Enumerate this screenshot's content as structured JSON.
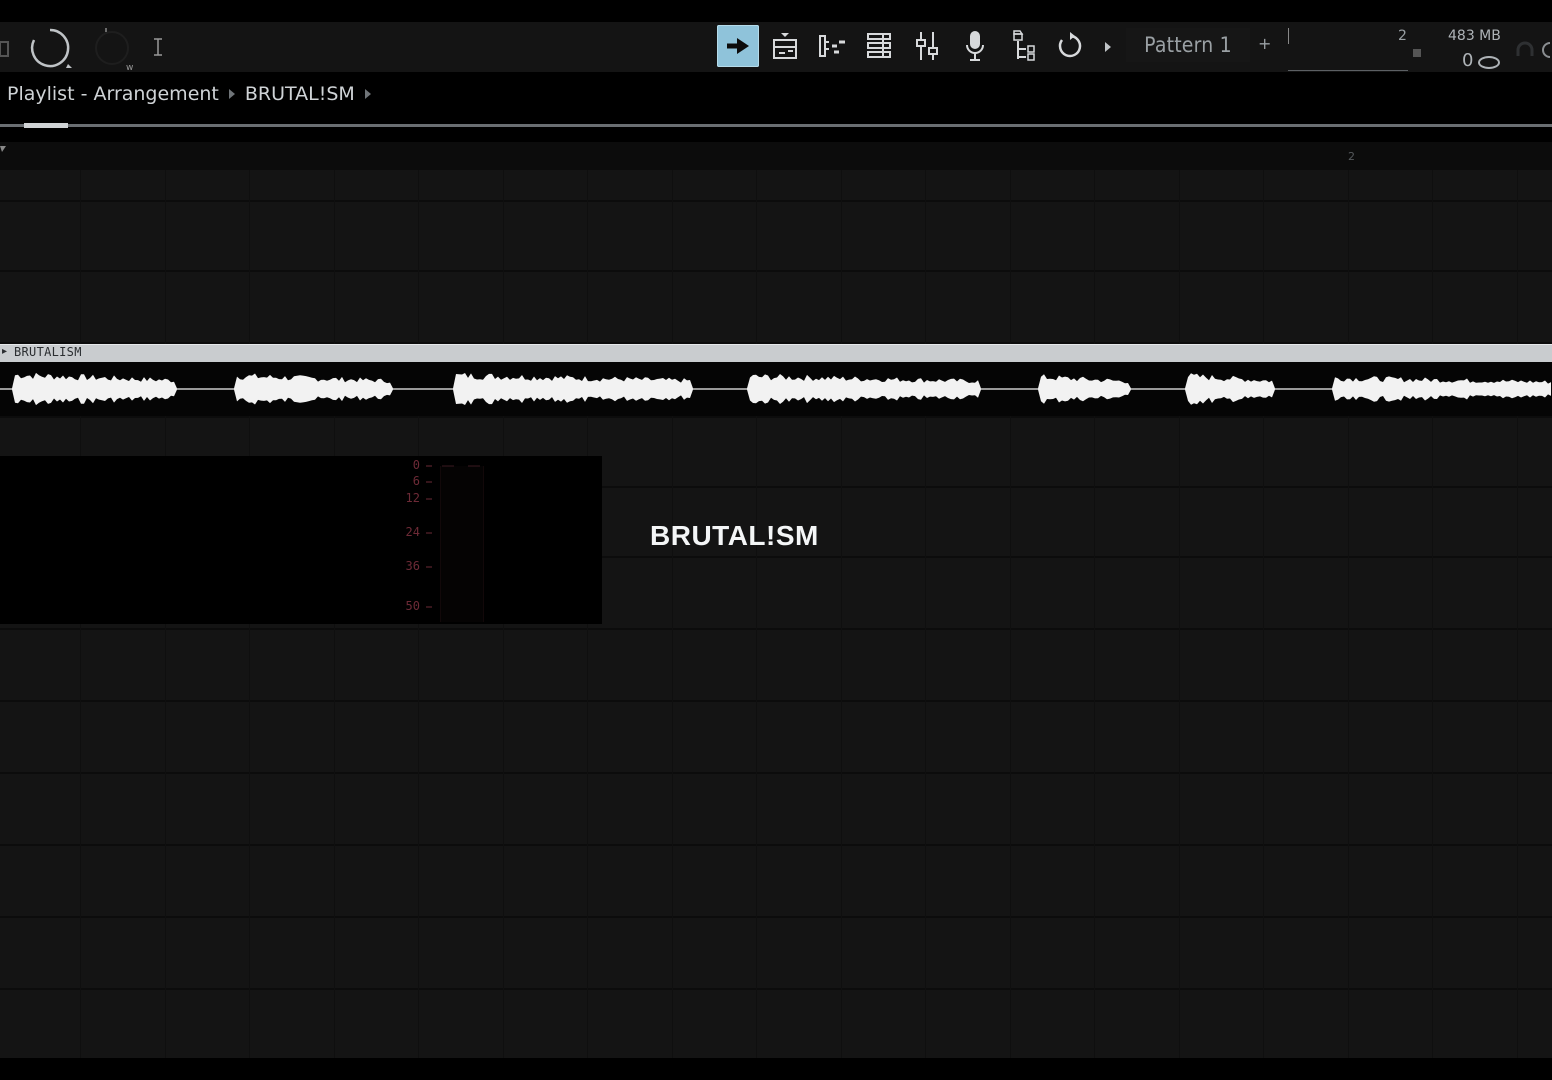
{
  "toolbar": {
    "pattern_label": "Pattern 1",
    "add_label": "+",
    "time_value": "2",
    "memory": "483 MB",
    "cpu_value": "0"
  },
  "breadcrumb": {
    "items": [
      "Playlist - Arrangement",
      "BRUTAL!SM"
    ]
  },
  "ruler": {
    "bar_label": "2"
  },
  "clip": {
    "title": "BRUTALISM"
  },
  "meter": {
    "labels": [
      "0",
      "6",
      "12",
      "24",
      "36",
      "50"
    ]
  },
  "overlay_title": "BRUTAL!SM",
  "colors": {
    "active_button": "#8fc3da",
    "grid_bg": "#141414",
    "clip_header": "#c9cccf",
    "meter_label": "#6d2a36"
  }
}
